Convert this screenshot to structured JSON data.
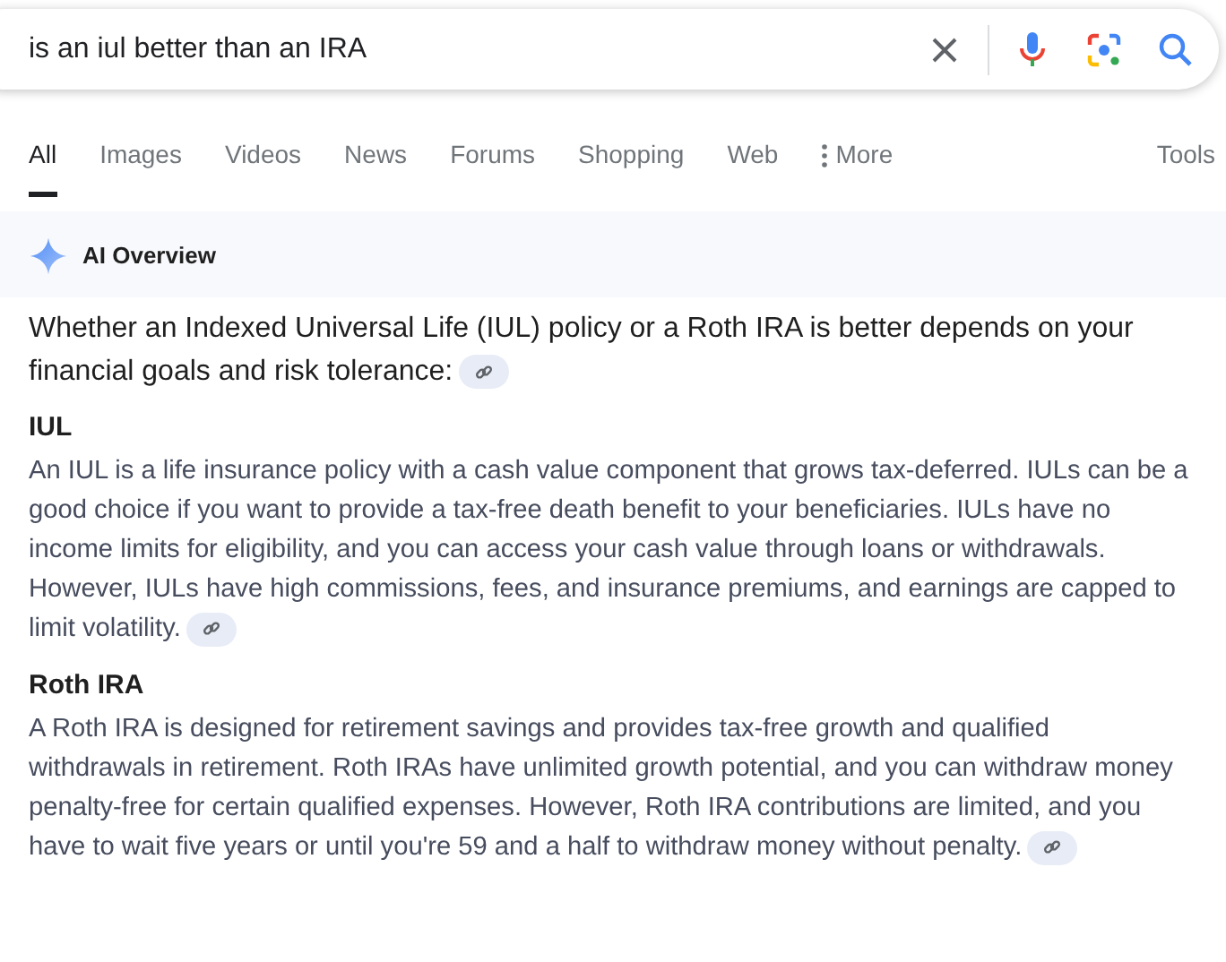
{
  "search": {
    "value": "is an iul better than an IRA"
  },
  "tabs": [
    {
      "label": "All",
      "selected": true
    },
    {
      "label": "Images",
      "selected": false
    },
    {
      "label": "Videos",
      "selected": false
    },
    {
      "label": "News",
      "selected": false
    },
    {
      "label": "Forums",
      "selected": false
    },
    {
      "label": "Shopping",
      "selected": false
    },
    {
      "label": "Web",
      "selected": false
    },
    {
      "label": "More",
      "selected": false,
      "kind": "menu"
    }
  ],
  "tools": "Tools",
  "ai_overview": {
    "title": "AI Overview",
    "intro": "Whether an Indexed Universal Life (IUL) policy or a Roth IRA is better depends on your financial goals and risk tolerance:",
    "sections": [
      {
        "heading": "IUL",
        "text": "An IUL is a life insurance policy with a cash value component that grows tax-deferred. IULs can be a good choice if you want to provide a tax-free death benefit to your beneficiaries. IULs have no income limits for eligibility, and you can access your cash value through loans or withdrawals. However, IULs have high commissions, fees, and insurance premiums, and earnings are capped to limit volatility."
      },
      {
        "heading": "Roth IRA",
        "text": "A Roth IRA is designed for retirement savings and provides tax-free growth and qualified withdrawals in retirement. Roth IRAs have unlimited growth potential, and you can withdraw money penalty-free for certain qualified expenses. However, Roth IRA contributions are limited, and you have to wait five years or until you're 59 and a half to withdraw money without penalty."
      }
    ]
  }
}
